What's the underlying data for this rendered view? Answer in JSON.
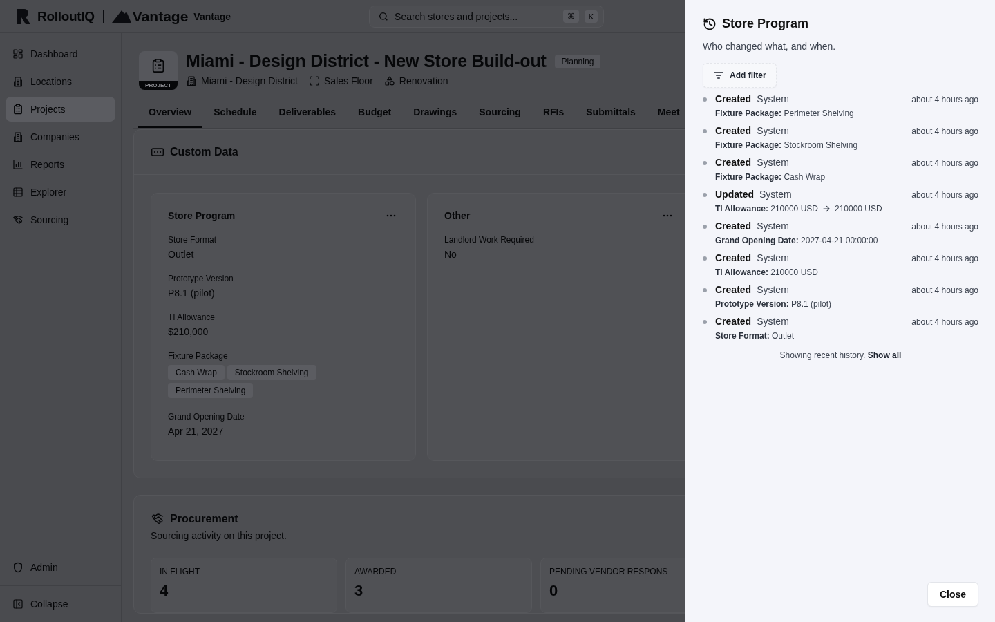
{
  "header": {
    "logo": "RolloutIQ",
    "brand": "Vantage",
    "workspace": "Vantage",
    "search": {
      "placeholder": "Search stores and projects..."
    },
    "shortcut": [
      "⌘",
      "K"
    ]
  },
  "sidebar": {
    "items": [
      {
        "label": "Dashboard",
        "selected": false
      },
      {
        "label": "Locations",
        "selected": false
      },
      {
        "label": "Projects",
        "selected": true
      },
      {
        "label": "Companies",
        "selected": false
      },
      {
        "label": "Reports",
        "selected": false
      },
      {
        "label": "Explorer",
        "selected": false
      },
      {
        "label": "Sourcing",
        "selected": false
      }
    ],
    "footer": [
      {
        "label": "Admin"
      },
      {
        "label": "Collapse"
      }
    ]
  },
  "project": {
    "badge": "PROJECT",
    "title": "Miami - Design District - New Store Build-out",
    "status": "Planning",
    "meta": [
      "Miami - Design District",
      "Sales Floor",
      "Renovation"
    ]
  },
  "tabs": [
    {
      "label": "Overview",
      "selected": true
    },
    {
      "label": "Schedule",
      "selected": false
    },
    {
      "label": "Deliverables",
      "selected": false
    },
    {
      "label": "Budget",
      "selected": false
    },
    {
      "label": "Drawings",
      "selected": false
    },
    {
      "label": "Sourcing",
      "selected": false
    },
    {
      "label": "RFIs",
      "selected": false
    },
    {
      "label": "Submittals",
      "selected": false
    },
    {
      "label": "Meet",
      "selected": false
    }
  ],
  "custom_data": {
    "title": "Custom Data",
    "cards": [
      {
        "title": "Store Program",
        "fields": [
          {
            "kind": "value",
            "label": "Store Format",
            "value": "Outlet"
          },
          {
            "kind": "value",
            "label": "Prototype Version",
            "value": "P8.1 (pilot)"
          },
          {
            "kind": "value",
            "label": "TI Allowance",
            "value": "$210,000"
          },
          {
            "kind": "tags",
            "label": "Fixture Package",
            "tags": [
              "Cash Wrap",
              "Stockroom Shelving",
              "Perimeter Shelving"
            ]
          },
          {
            "kind": "value",
            "label": "Grand Opening Date",
            "value": "Apr 21, 2027"
          }
        ]
      },
      {
        "title": "Other",
        "fields": [
          {
            "kind": "value",
            "label": "Landlord Work Required",
            "value": "No"
          }
        ]
      }
    ]
  },
  "procurement": {
    "title": "Procurement",
    "subtitle": "Sourcing activity on this project.",
    "stats": [
      {
        "label": "IN FLIGHT",
        "value": "4"
      },
      {
        "label": "AWARDED",
        "value": "3"
      },
      {
        "label": "PENDING VENDOR RESPONS",
        "value": "0"
      }
    ]
  },
  "drawer": {
    "title": "Store Program",
    "subtitle": "Who changed what, and when.",
    "filter_button": "Add filter",
    "entries": [
      {
        "action": "Created",
        "actor": "System",
        "time": "about 4 hours ago",
        "field": "Fixture Package:",
        "value": "Perimeter Shelving"
      },
      {
        "action": "Created",
        "actor": "System",
        "time": "about 4 hours ago",
        "field": "Fixture Package:",
        "value": "Stockroom Shelving"
      },
      {
        "action": "Created",
        "actor": "System",
        "time": "about 4 hours ago",
        "field": "Fixture Package:",
        "value": "Cash Wrap"
      },
      {
        "action": "Updated",
        "actor": "System",
        "time": "about 4 hours ago",
        "field": "TI Allowance:",
        "old_value": "210000 USD",
        "value": "210000 USD"
      },
      {
        "action": "Created",
        "actor": "System",
        "time": "about 4 hours ago",
        "field": "Grand Opening Date:",
        "value": "2027-04-21 00:00:00"
      },
      {
        "action": "Created",
        "actor": "System",
        "time": "about 4 hours ago",
        "field": "TI Allowance:",
        "value": "210000 USD"
      },
      {
        "action": "Created",
        "actor": "System",
        "time": "about 4 hours ago",
        "field": "Prototype Version:",
        "value": "P8.1 (pilot)"
      },
      {
        "action": "Created",
        "actor": "System",
        "time": "about 4 hours ago",
        "field": "Store Format:",
        "value": "Outlet"
      }
    ],
    "footer_note": "Showing recent history.",
    "show_all": "Show all",
    "close_button": "Close"
  }
}
